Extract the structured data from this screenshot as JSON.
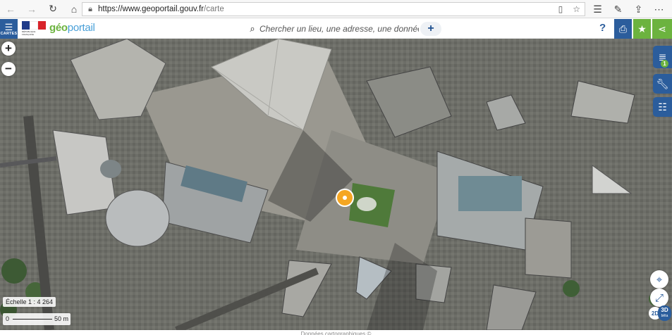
{
  "browser": {
    "back_icon": "arrow-left-icon",
    "forward_icon": "arrow-right-icon",
    "reload_icon": "reload-icon",
    "home_icon": "home-icon",
    "url_domain": "https://www.geoportail.gouv.fr",
    "url_path": "/carte"
  },
  "header": {
    "menu_label": "CARTES",
    "brand_geo": "géo",
    "brand_portail": "portail",
    "flag_caption": "RÉPUBLIQUE FRANÇAISE",
    "search_placeholder": "Chercher un lieu, une adresse, une donnée",
    "search_add": "+",
    "help": "?"
  },
  "colors": {
    "brand_blue": "#2b5d9c",
    "brand_green": "#6cb33f",
    "marker": "#f5a623",
    "flag_blue": "#1f3b8a",
    "flag_red": "#d8232a"
  },
  "map": {
    "layer_count": "1",
    "scale_label": "Échelle 1 : 4 264",
    "scale_zero": "0",
    "scale_max": "50 m",
    "toggle_2d": "2D",
    "toggle_3d": "3D",
    "toggle_beta": "bêta",
    "attribution": "Données cartographiques ©"
  }
}
